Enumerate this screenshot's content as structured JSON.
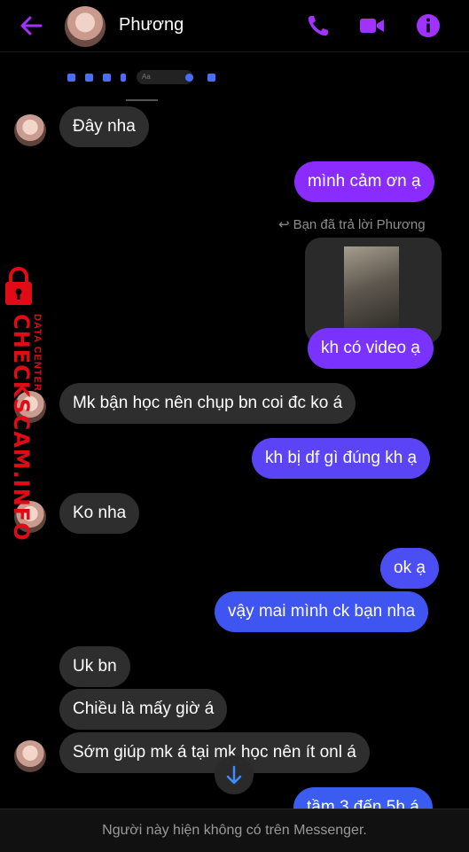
{
  "header": {
    "contact_name": "Phương",
    "accent_color": "#a033ff"
  },
  "mini_bar": {
    "input_placeholder": "Aa"
  },
  "messages": [
    {
      "from": "them",
      "text": "Đây nha"
    },
    {
      "from": "me",
      "text": "mình cảm ơn ạ"
    },
    {
      "from": "me",
      "text": "kh có video ạ"
    },
    {
      "from": "them",
      "text": "Mk bận học nên chụp bn coi đc ko á"
    },
    {
      "from": "me",
      "text": "kh bị df gì đúng kh ạ"
    },
    {
      "from": "them",
      "text": "Ko nha"
    },
    {
      "from": "me",
      "text": "ok ạ"
    },
    {
      "from": "me",
      "text": "vậy mai mình ck bạn nha"
    },
    {
      "from": "them",
      "text": "Uk bn"
    },
    {
      "from": "them",
      "text": "Chiều là mấy giờ á"
    },
    {
      "from": "them",
      "text": "Sớm giúp mk á tại mk học nên ít onl á"
    },
    {
      "from": "me",
      "text": "tầm 3 đến 5h á"
    }
  ],
  "reply_label": "Bạn đã trả lời Phương",
  "watermark": {
    "brand": "CHECKSCAM.INFO",
    "sub": "DATA CENTER"
  },
  "footer_text": "Người này hiện không có trên Messenger.",
  "colors": {
    "outgoing_top": "#a033ff",
    "outgoing_bottom": "#3d5cf0",
    "incoming": "#2e2e2e",
    "watermark": "#e10b16"
  }
}
